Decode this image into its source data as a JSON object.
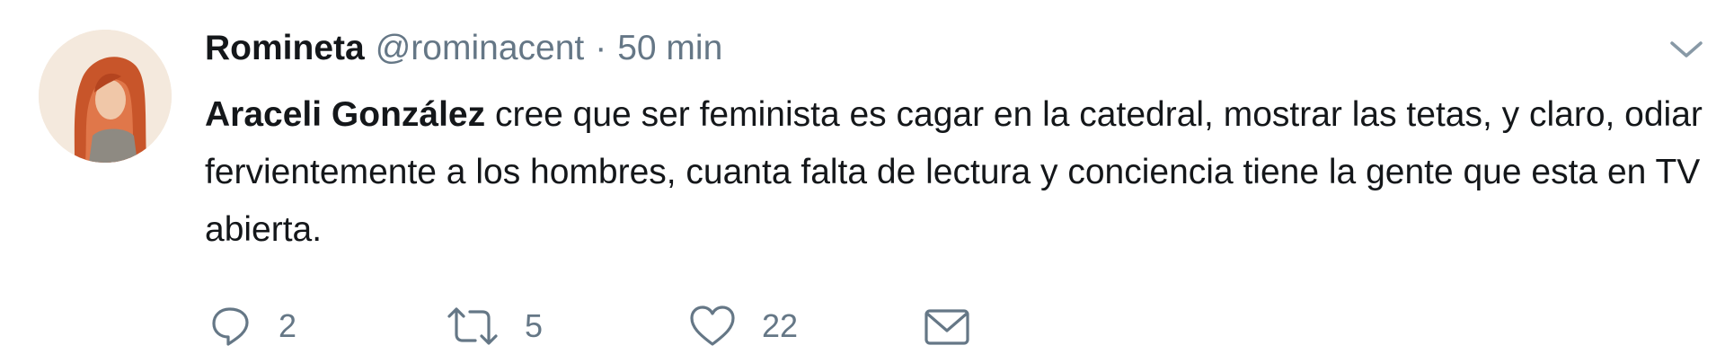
{
  "tweet": {
    "author": {
      "display_name": "Romineta",
      "handle": "@rominacent",
      "avatar_icon": "user-avatar"
    },
    "separator": "·",
    "timestamp": "50 min",
    "text": {
      "mention": "Araceli González",
      "body": " cree que ser feminista es cagar en la catedral, mostrar las tetas, y claro, odiar fervientemente a los hombres, cuanta falta de lectura y conciencia tiene la gente que esta en TV abierta."
    },
    "actions": {
      "reply": {
        "icon": "reply-icon",
        "count": "2"
      },
      "retweet": {
        "icon": "retweet-icon",
        "count": "5"
      },
      "like": {
        "icon": "heart-icon",
        "count": "22"
      },
      "direct_message": {
        "icon": "envelope-icon"
      }
    },
    "menu_icon": "chevron-down-icon"
  },
  "colors": {
    "text": "#14171a",
    "secondary": "#657786",
    "background": "#ffffff"
  }
}
